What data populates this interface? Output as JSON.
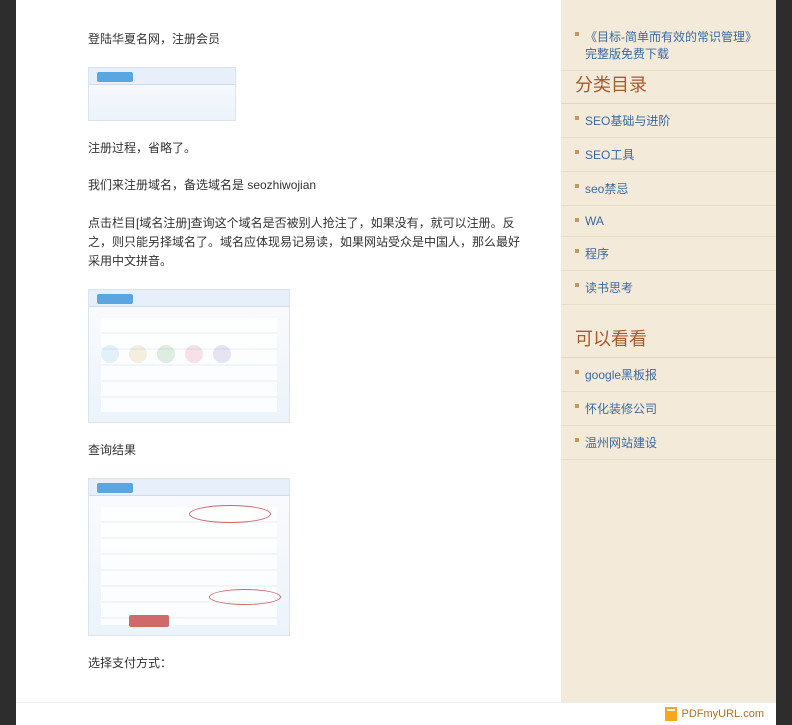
{
  "content": {
    "para1": "登陆华夏名网，注册会员",
    "para2": "注册过程，省略了。",
    "para3": "我们来注册域名，备选域名是 seozhiwojian",
    "para4": "点击栏目[域名注册]查询这个域名是否被别人抢注了，如果没有，就可以注册。反之，则只能另择域名了。域名应体现易记易读，如果网站受众是中国人，那么最好采用中文拼音。",
    "para5": "查询结果",
    "para6": "选择支付方式："
  },
  "sidebar": {
    "top_link": "《目标-简单而有效的常识管理》完整版免费下载",
    "cat_title": "分类目录",
    "categories": [
      {
        "label": "SEO基础与进阶"
      },
      {
        "label": "SEO工具"
      },
      {
        "label": "seo禁忌"
      },
      {
        "label": "WA"
      },
      {
        "label": "程序"
      },
      {
        "label": "读书思考"
      }
    ],
    "see_title": "可以看看",
    "see_links": [
      {
        "label": "google黑板报"
      },
      {
        "label": "怀化装修公司"
      },
      {
        "label": "温州网站建设"
      }
    ]
  },
  "footer": {
    "pdf_link": "PDFmyURL.com"
  }
}
